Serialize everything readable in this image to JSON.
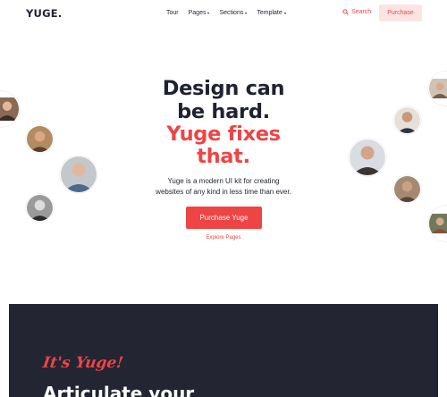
{
  "nav": {
    "logo": "YUGE.",
    "links": [
      {
        "label": "Tour",
        "dropdown": false
      },
      {
        "label": "Pages",
        "dropdown": true
      },
      {
        "label": "Sections",
        "dropdown": true
      },
      {
        "label": "Template",
        "dropdown": true
      }
    ],
    "search_label": "Search",
    "purchase_label": "Purchase"
  },
  "hero": {
    "headline_line1": "Design can",
    "headline_line2": "be hard.",
    "headline_line3": "Yuge fixes",
    "headline_line4": "that.",
    "subtitle_line1": "Yuge is a modern UI kit for creating",
    "subtitle_line2": "websites of any kind in less time than ever.",
    "cta_label": "Purchase Yuge",
    "secondary_link": "Explore Pages"
  },
  "section2": {
    "script_text": "It's Yuge!",
    "heading": "Articulate your"
  },
  "colors": {
    "accent": "#ef4444",
    "accent_light": "#fde4e3",
    "text_dark": "#1f2230",
    "dark_bg": "#232532"
  },
  "icons": {
    "search": "search-icon",
    "dropdown": "chevron-down-icon"
  }
}
